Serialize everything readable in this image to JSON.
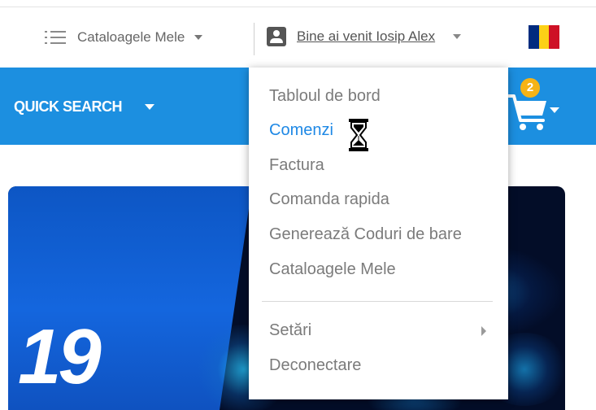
{
  "header": {
    "catalogs_label": "Cataloagele Mele",
    "welcome_text": "Bine ai venit Iosip Alex",
    "flag_colors": [
      "#002b7f",
      "#fcd116",
      "#ce1126"
    ]
  },
  "navbar": {
    "quick_search_label": "QUICK SEARCH",
    "cart_count": "2",
    "bar_color": "#1c8fe0"
  },
  "banner": {
    "number_text": "19"
  },
  "dropdown": {
    "items": [
      {
        "label": "Tabloul de bord"
      },
      {
        "label": "Comenzi"
      },
      {
        "label": "Factura"
      },
      {
        "label": "Comanda rapida"
      },
      {
        "label": "Generează Coduri de bare"
      },
      {
        "label": "Cataloagele Mele"
      },
      {
        "label": "Setări"
      },
      {
        "label": "Deconectare"
      }
    ],
    "active_color": "#1e88e5",
    "text_color": "#7b7b7b"
  },
  "cursor": {
    "icon": "hourglass-icon"
  }
}
